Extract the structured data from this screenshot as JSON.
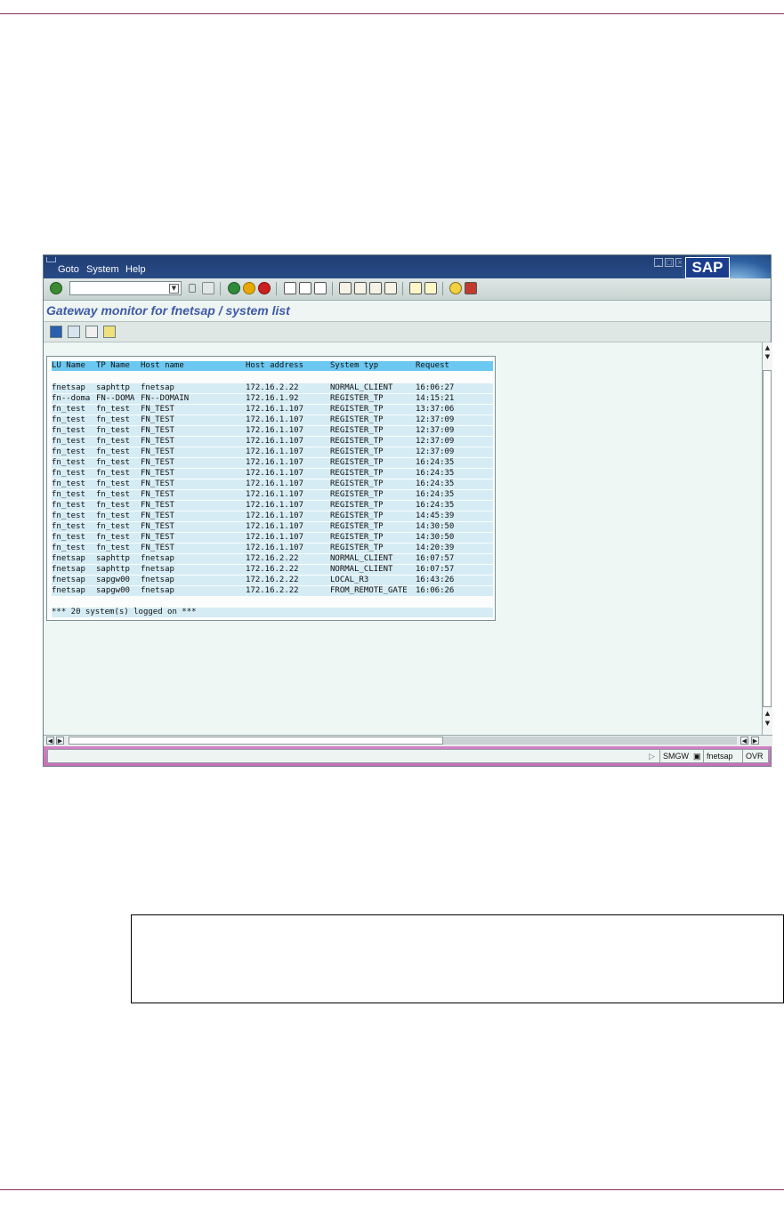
{
  "window": {
    "menu": [
      {
        "label": "Goto"
      },
      {
        "label": "System"
      },
      {
        "label": "Help"
      }
    ],
    "logo_text": "SAP",
    "screen_title": "Gateway monitor for fnetsap / system list"
  },
  "toolbar": {
    "command_value": "",
    "icons": [
      "enter-icon",
      "back-icon",
      "exit-icon",
      "cancel-icon",
      "print-icon",
      "find-icon",
      "find-next-icon",
      "first-page-icon",
      "previous-page-icon",
      "next-page-icon",
      "last-page-icon",
      "create-session-icon",
      "shortcut-icon",
      "help-icon",
      "layout-icon"
    ]
  },
  "app_toolbar": {
    "icons": [
      "refresh-icon",
      "details-icon",
      "print-list-icon",
      "filter-icon"
    ]
  },
  "list": {
    "columns": [
      "LU Name",
      "TP Name",
      "Host name",
      "Host address",
      "System typ",
      "Request"
    ],
    "rows": [
      [
        "fnetsap",
        "saphttp",
        "fnetsap",
        "172.16.2.22",
        "NORMAL_CLIENT",
        "16:06:27"
      ],
      [
        "fn--doma",
        "FN--DOMA",
        "FN--DOMAIN",
        "172.16.1.92",
        "REGISTER_TP",
        "14:15:21"
      ],
      [
        "fn_test",
        "fn_test",
        "FN_TEST",
        "172.16.1.107",
        "REGISTER_TP",
        "13:37:06"
      ],
      [
        "fn_test",
        "fn_test",
        "FN_TEST",
        "172.16.1.107",
        "REGISTER_TP",
        "12:37:09"
      ],
      [
        "fn_test",
        "fn_test",
        "FN_TEST",
        "172.16.1.107",
        "REGISTER_TP",
        "12:37:09"
      ],
      [
        "fn_test",
        "fn_test",
        "FN_TEST",
        "172.16.1.107",
        "REGISTER_TP",
        "12:37:09"
      ],
      [
        "fn_test",
        "fn_test",
        "FN_TEST",
        "172.16.1.107",
        "REGISTER_TP",
        "12:37:09"
      ],
      [
        "fn_test",
        "fn_test",
        "FN_TEST",
        "172.16.1.107",
        "REGISTER_TP",
        "16:24:35"
      ],
      [
        "fn_test",
        "fn_test",
        "FN_TEST",
        "172.16.1.107",
        "REGISTER_TP",
        "16:24:35"
      ],
      [
        "fn_test",
        "fn_test",
        "FN_TEST",
        "172.16.1.107",
        "REGISTER_TP",
        "16:24:35"
      ],
      [
        "fn_test",
        "fn_test",
        "FN_TEST",
        "172.16.1.107",
        "REGISTER_TP",
        "16:24:35"
      ],
      [
        "fn_test",
        "fn_test",
        "FN_TEST",
        "172.16.1.107",
        "REGISTER_TP",
        "16:24:35"
      ],
      [
        "fn_test",
        "fn_test",
        "FN_TEST",
        "172.16.1.107",
        "REGISTER_TP",
        "14:45:39"
      ],
      [
        "fn_test",
        "fn_test",
        "FN_TEST",
        "172.16.1.107",
        "REGISTER_TP",
        "14:30:50"
      ],
      [
        "fn_test",
        "fn_test",
        "FN_TEST",
        "172.16.1.107",
        "REGISTER_TP",
        "14:30:50"
      ],
      [
        "fn_test",
        "fn_test",
        "FN_TEST",
        "172.16.1.107",
        "REGISTER_TP",
        "14:20:39"
      ],
      [
        "fnetsap",
        "saphttp",
        "fnetsap",
        "172.16.2.22",
        "NORMAL_CLIENT",
        "16:07:57"
      ],
      [
        "fnetsap",
        "saphttp",
        "fnetsap",
        "172.16.2.22",
        "NORMAL_CLIENT",
        "16:07:57"
      ],
      [
        "fnetsap",
        "sapgw00",
        "fnetsap",
        "172.16.2.22",
        "LOCAL_R3",
        "16:43:26"
      ],
      [
        "fnetsap",
        "sapgw00",
        "fnetsap",
        "172.16.2.22",
        "FROM_REMOTE_GATE",
        "16:06:26"
      ]
    ],
    "footer": "*** 20 system(s) logged on ***"
  },
  "status": {
    "transaction": "SMGW",
    "server": "fnetsap",
    "mode": "OVR"
  },
  "colors": {
    "menubar": "#1f3e74",
    "title": "#3f5aa8",
    "list_header": "#6bc8f0",
    "list_row": "#d6ecf4",
    "statusbar": "#cf77bf",
    "page_rule": "#8a2a5a"
  }
}
